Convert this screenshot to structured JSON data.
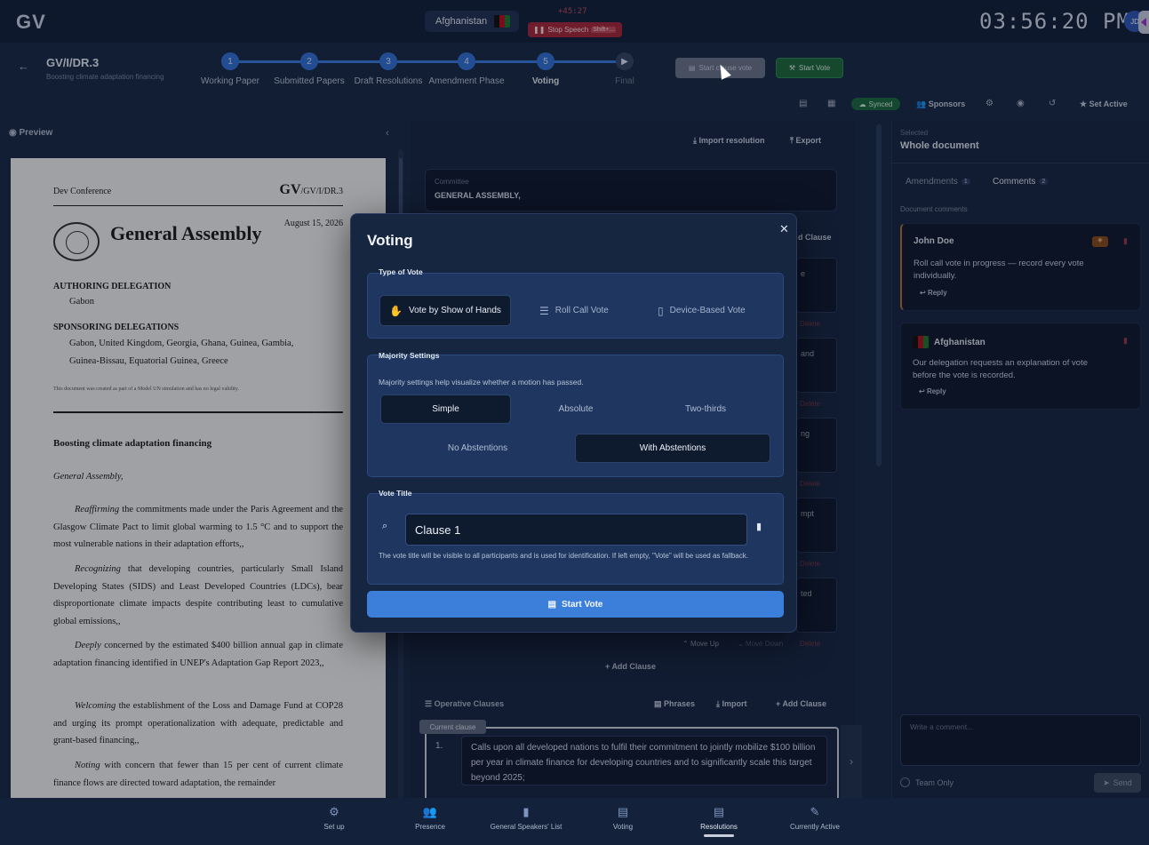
{
  "app": {
    "logo": "GV",
    "clock": "03:56:20 PM",
    "avatar_initials": "JD"
  },
  "speaker": {
    "country": "Afghanistan",
    "timer": "+45:27",
    "stop_label": "Stop Speech",
    "stop_shortcut": "Shift+..."
  },
  "document": {
    "code": "GV/I/DR.3",
    "subtitle": "Boosting climate adaptation financing"
  },
  "stepper": [
    {
      "num": "1",
      "label": "Working Paper"
    },
    {
      "num": "2",
      "label": "Submitted Papers"
    },
    {
      "num": "3",
      "label": "Draft Resolutions"
    },
    {
      "num": "4",
      "label": "Amendment Phase"
    },
    {
      "num": "5",
      "label": "Voting"
    },
    {
      "num": "▶",
      "label": "Final"
    }
  ],
  "header_buttons": {
    "start_clause_vote": "Start clause vote",
    "start_vote": "Start Vote"
  },
  "toolbar": {
    "synced": "Synced",
    "sponsors": "Sponsors",
    "set_active": "Set Active"
  },
  "preview": {
    "label": "Preview",
    "conference": "Dev Conference",
    "code_big": "GV",
    "code_small": "/GV/I/DR.3",
    "body_name": "General Assembly",
    "date": "August 15, 2026",
    "authoring_heading": "AUTHORING DELEGATION",
    "authoring": "Gabon",
    "sponsoring_heading": "SPONSORING DELEGATIONS",
    "sponsoring_1": "Gabon, United Kingdom, Georgia, Ghana, Guinea, Gambia,",
    "sponsoring_2": "Guinea-Bissau, Equatorial Guinea, Greece",
    "disclaimer": "This document was created as part of a Model UN simulation and has no legal validity.",
    "title": "Boosting climate adaptation financing",
    "opening": "General Assembly,",
    "clauses": [
      {
        "lead": "Reaffirming",
        "text": " the commitments made under the Paris Agreement and the Glasgow Climate Pact to limit global warming to 1.5 °C and to support the most vulnerable nations in their adaptation efforts,,"
      },
      {
        "lead": "Recognizing",
        "text": " that developing countries, particularly Small Island Developing States (SIDS) and Least Developed Countries (LDCs), bear disproportionate climate impacts despite contributing least to cumulative global emissions,,"
      },
      {
        "lead": "Deeply",
        "text": " concerned by the estimated $400 billion annual gap in climate adaptation financing identified in UNEP's Adaptation Gap Report 2023,,"
      },
      {
        "lead": "Welcoming",
        "text": " the establishment of the Loss and Damage Fund at COP28 and urging its prompt operationalization with adequate, predictable and grant-based financing,,"
      },
      {
        "lead": "Noting",
        "text": " with concern that fewer than 15 per cent of current climate finance flows are directed toward adaptation, the remainder"
      }
    ]
  },
  "editor": {
    "import_resolution": "Import resolution",
    "export": "Export",
    "committee_label": "Committee",
    "committee_value": "GENERAL ASSEMBLY,",
    "add_clause_partial": "d Clause",
    "clause_snippets": [
      "e",
      "and",
      "ng",
      "mpt",
      "ted"
    ],
    "delete": "Delete",
    "move_up": "Move Up",
    "move_down": "Move Down",
    "add_clause": "Add Clause",
    "operative_heading": "Operative Clauses",
    "phrases": "Phrases",
    "import": "Import",
    "current_clause": "Current clause",
    "op_number": "1.",
    "op_text": "Calls upon all developed nations to fulfil their commitment to jointly mobilize $100 billion per year in climate finance for developing countries and to significantly scale this target beyond 2025;"
  },
  "comments_panel": {
    "selected_label": "Selected",
    "selected_value": "Whole document",
    "tabs": [
      {
        "label": "Amendments",
        "count": "1"
      },
      {
        "label": "Comments",
        "count": "2"
      }
    ],
    "section_label": "Document comments",
    "comments": [
      {
        "author": "John Doe",
        "text": "Roll call vote in progress — record every vote individually.",
        "reply": "Reply"
      },
      {
        "author": "Afghanistan",
        "text": "Our delegation requests an explanation of vote before the vote is recorded.",
        "reply": "Reply"
      }
    ],
    "input_placeholder": "Write a comment...",
    "team_only": "Team Only",
    "send": "Send"
  },
  "bottom_nav": [
    {
      "label": "Set up",
      "icon": "gear-users-icon"
    },
    {
      "label": "Presence",
      "icon": "people-icon"
    },
    {
      "label": "General Speakers' List",
      "icon": "trash-list-icon"
    },
    {
      "label": "Voting",
      "icon": "ballot-icon"
    },
    {
      "label": "Resolutions",
      "icon": "document-icon"
    },
    {
      "label": "Currently Active",
      "icon": "edit-doc-icon"
    }
  ],
  "modal": {
    "title": "Voting",
    "type_heading": "Type of Vote",
    "vote_types": [
      "Vote by Show of Hands",
      "Roll Call Vote",
      "Device-Based Vote"
    ],
    "majority_heading": "Majority Settings",
    "majority_help": "Majority settings help visualize whether a motion has passed.",
    "majority_options": [
      "Simple",
      "Absolute",
      "Two-thirds"
    ],
    "abstention_options": [
      "No Abstentions",
      "With Abstentions"
    ],
    "vote_title_heading": "Vote Title",
    "vote_title_value": "Clause 1",
    "vote_title_help": "The vote title will be visible to all participants and is used for identification. If left empty, \"Vote\" will be used as fallback.",
    "start_vote": "Start Vote"
  },
  "colors": {
    "accent": "#3b7fdb",
    "success": "#1f6b3c",
    "danger": "#a8293a",
    "background": "#1a2a45"
  }
}
